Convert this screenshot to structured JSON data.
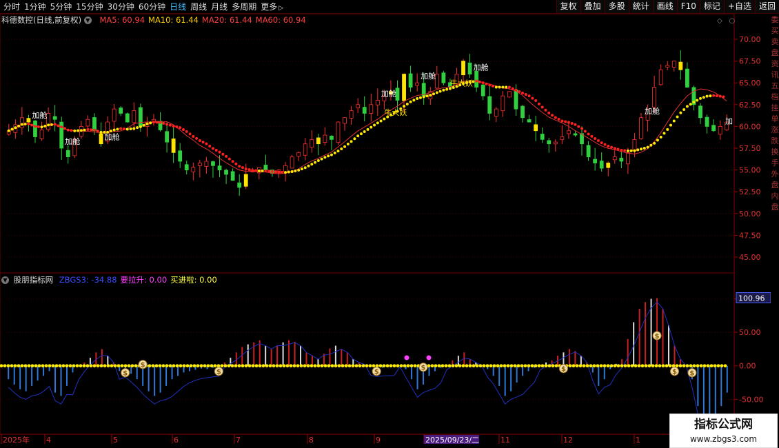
{
  "toolbar": {
    "period_tabs": [
      "分时",
      "1分钟",
      "5分钟",
      "15分钟",
      "30分钟",
      "60分钟",
      "日线",
      "周线",
      "月线",
      "多周期",
      "更多"
    ],
    "active_tab": "日线",
    "buttons": [
      "复权",
      "叠加",
      "多股",
      "统计",
      "画线",
      "F10",
      "标记",
      "+自选",
      "返回"
    ]
  },
  "main_panel": {
    "title": "科德数控(日线,前复权)",
    "ma": [
      {
        "label": "MA5: 60.94",
        "color": "#ff4040"
      },
      {
        "label": "MA10: 61.44",
        "color": "#ffd000"
      },
      {
        "label": "MA20: 61.44",
        "color": "#ff4040"
      },
      {
        "label": "MA60: 60.94",
        "color": "#ff4040"
      }
    ],
    "annotations": {
      "add_label": "加舱",
      "bull_label": "牛大妖",
      "add_partial": "加"
    }
  },
  "indicator_panel": {
    "title": "股朋指标网",
    "items": [
      {
        "label": "ZBGS3: -34.88",
        "color": "#3a4cff"
      },
      {
        "label": "要拉升: 0.00",
        "color": "#ff40ff"
      },
      {
        "label": "买进啦: 0.00",
        "color": "#ffff40"
      }
    ],
    "current_value": "100.96"
  },
  "chart_data": [
    {
      "type": "candlestick",
      "title": "科德数控(日线,前复权)",
      "y_ticks": [
        "70.00",
        "67.50",
        "65.00",
        "62.50",
        "60.00",
        "57.50",
        "55.00",
        "52.50",
        "50.00",
        "47.50",
        "45.00"
      ],
      "ylim": [
        43.5,
        71.5
      ],
      "x_date_labels": [
        "2025年",
        "4",
        "5",
        "6",
        "7",
        "8",
        "9",
        "2025/09/23/二",
        "11",
        "12",
        "1"
      ],
      "closes": [
        59.5,
        60.2,
        61.0,
        60.5,
        58.8,
        59.6,
        61.5,
        60.8,
        57.5,
        56.5,
        58.5,
        60.0,
        60.8,
        59.5,
        58.0,
        60.5,
        62.0,
        61.5,
        60.5,
        61.8,
        60.0,
        60.5,
        60.8,
        59.6,
        58.2,
        57.0,
        56.0,
        55.0,
        55.3,
        55.8,
        56.0,
        55.5,
        55.0,
        54.5,
        53.8,
        53.0,
        54.5,
        55.0,
        55.3,
        55.0,
        54.6,
        55.0,
        55.5,
        56.5,
        57.0,
        58.0,
        58.5,
        58.0,
        59.0,
        58.5,
        60.5,
        61.0,
        61.8,
        62.5,
        61.5,
        62.5,
        63.0,
        63.5,
        64.0,
        63.0,
        66.0,
        64.5,
        65.0,
        63.5,
        64.0,
        66.0,
        65.0,
        64.5,
        66.0,
        67.5,
        66.0,
        64.5,
        63.5,
        61.5,
        62.0,
        63.5,
        64.0,
        62.0,
        61.0,
        60.5,
        59.5,
        58.5,
        58.0,
        58.2,
        58.8,
        59.5,
        59.0,
        58.0,
        56.5,
        55.8,
        55.2,
        55.8,
        56.5,
        56.0,
        57.0,
        58.5,
        61.0,
        62.0,
        64.5,
        66.5,
        67.0,
        67.5,
        66.5,
        64.5,
        62.5,
        61.0,
        60.0,
        59.5,
        60.0,
        60.5
      ],
      "indicator": {
        "type": "histogram",
        "title": "股朋指标网",
        "y_ticks": [
          "100.00",
          "50.00",
          "0.00",
          "-50.00"
        ],
        "ylim": [
          -100,
          120
        ],
        "series": [
          {
            "name": "ZBGS3"
          }
        ],
        "values": [
          -20,
          -28,
          -35,
          -38,
          -30,
          -22,
          -15,
          -8,
          -40,
          -45,
          -30,
          -10,
          0,
          5,
          12,
          20,
          25,
          15,
          5,
          -8,
          -5,
          -12,
          -20,
          -30,
          -38,
          -45,
          -40,
          -30,
          -20,
          -15,
          -10,
          -8,
          -6,
          -4,
          -5,
          -3,
          -2,
          5,
          12,
          20,
          28,
          32,
          35,
          38,
          30,
          25,
          30,
          35,
          38,
          36,
          30,
          20,
          15,
          10,
          18,
          26,
          30,
          25,
          20,
          10,
          5,
          2,
          -2,
          -4,
          -3,
          -2,
          -1,
          0,
          -5,
          -20,
          -35,
          -28,
          -15,
          -8,
          -3,
          2,
          8,
          15,
          20,
          10,
          5,
          0,
          -5,
          -15,
          -30,
          -45,
          -38,
          -25,
          -15,
          -8,
          -3,
          2,
          5,
          8,
          15,
          20,
          25,
          22,
          15,
          5,
          -10,
          -30,
          -20,
          -5,
          3,
          10,
          40,
          65,
          85,
          95,
          100,
          101,
          85,
          60,
          30,
          10,
          0,
          -20,
          -60,
          -80,
          -95,
          -85,
          -60,
          -40
        ]
      },
      "signals": {
        "buy_markers": "$",
        "pink_dots": 2
      }
    }
  ],
  "watermark": {
    "title": "指标公式网",
    "url": "www.zbgs3.com"
  },
  "right_strip_text": "委买卖盘资讯五档挂单涨跌换手外盘内盘"
}
